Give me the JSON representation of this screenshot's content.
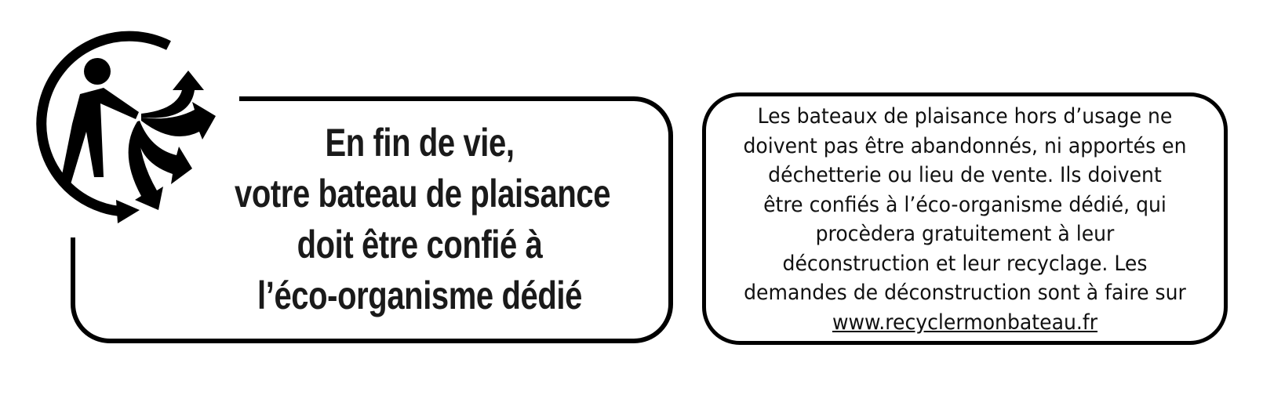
{
  "logo": {
    "name": "Triman logo",
    "icon": "triman-recycling-icon"
  },
  "left_panel": {
    "lines": [
      "En fin de vie,",
      "votre bateau de plaisance",
      "doit être confié à",
      "l’éco-organisme dédié"
    ]
  },
  "right_panel": {
    "lines": [
      "Les bateaux de plaisance hors d’usage ne",
      "doivent pas être abandonnés, ni apportés en",
      "déchetterie ou lieu de vente. Ils doivent",
      "être confiés à l’éco-organisme dédié, qui",
      "procèdera gratuitement à leur",
      "déconstruction et leur recyclage. Les",
      "demandes de déconstruction sont à faire sur"
    ],
    "link": "www.recyclermonbateau.fr"
  }
}
